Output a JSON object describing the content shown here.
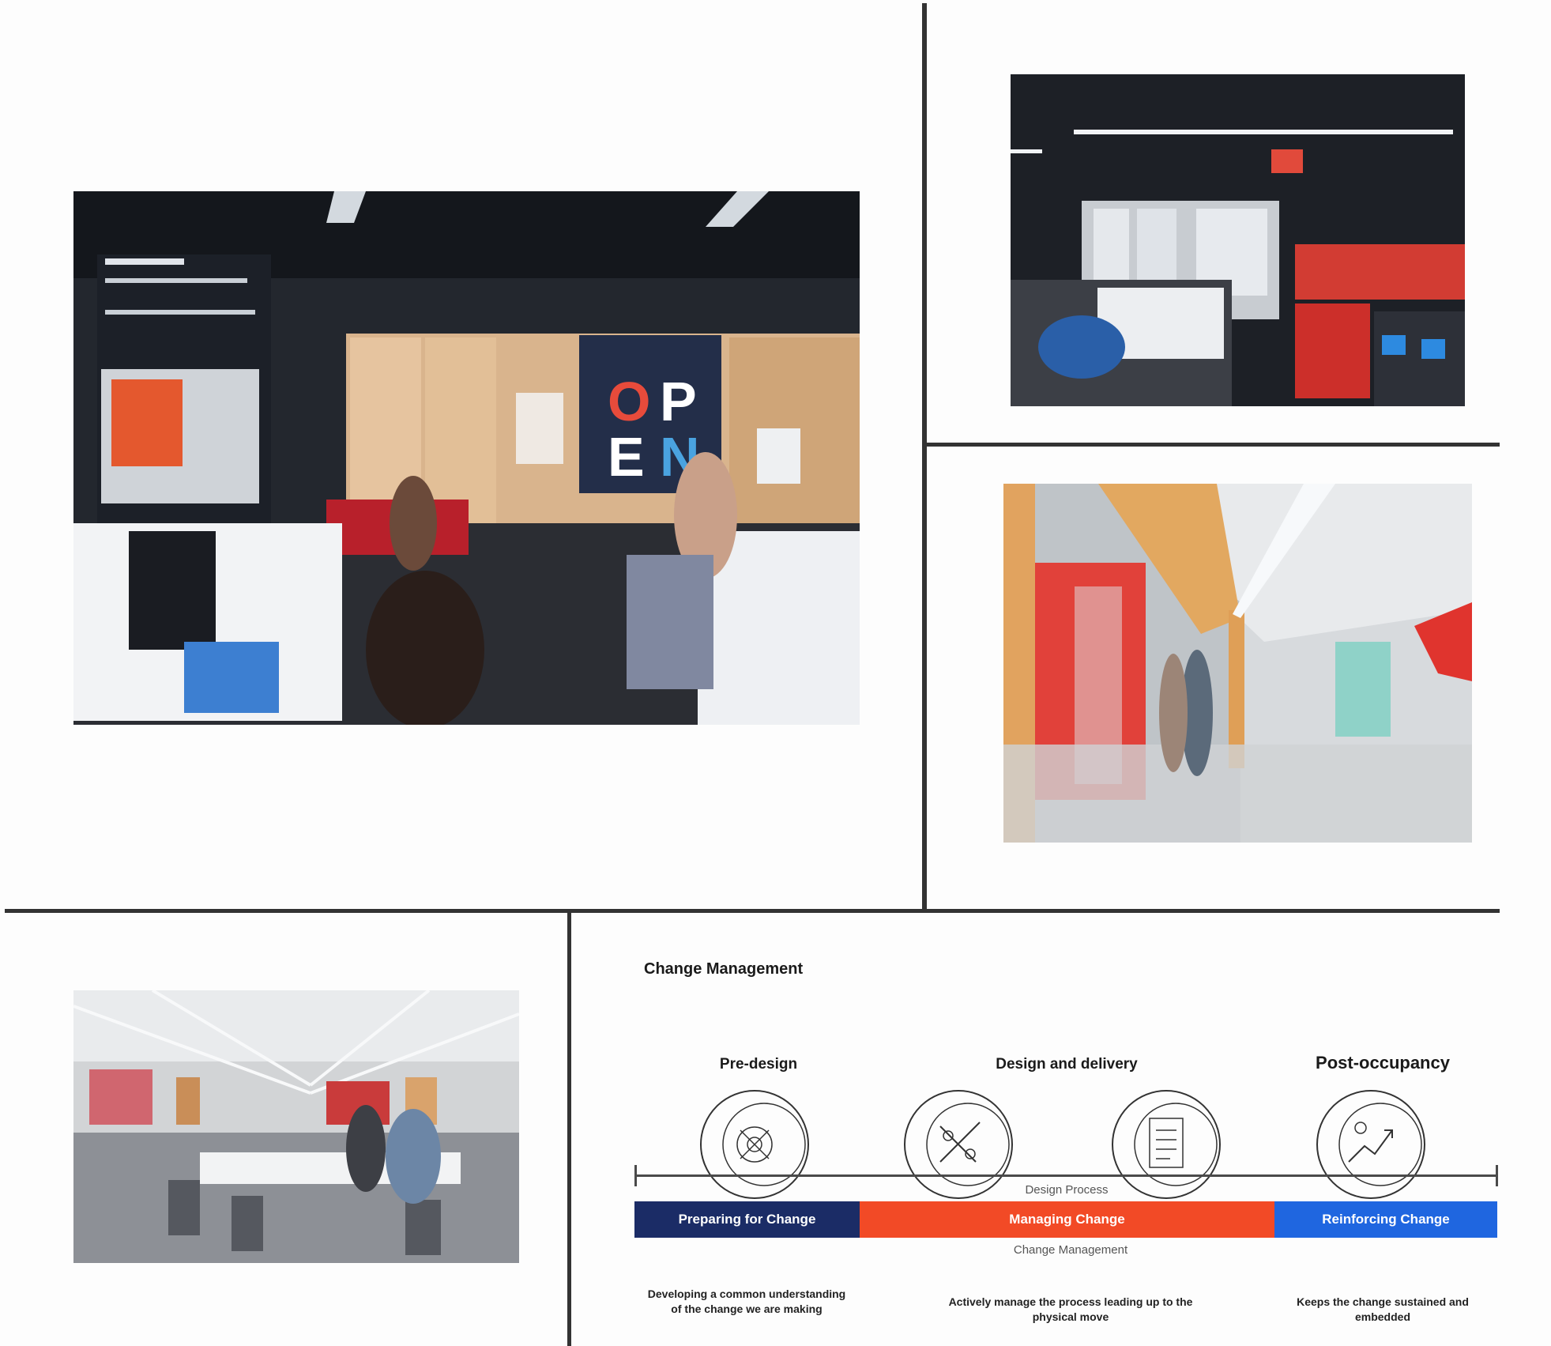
{
  "photos": {
    "main_office": {
      "sign_text": "OPEN",
      "sign_letters": [
        "O",
        "P",
        "E",
        "N"
      ]
    },
    "open_workspace": {},
    "corridor": {},
    "cafe_area": {}
  },
  "change_management": {
    "title": "Change Management",
    "phases": [
      {
        "label": "Pre-design",
        "icon": "strategy-target-icon"
      },
      {
        "label": "Design and delivery",
        "icon": "design-tools-icon"
      },
      {
        "label": "Design and delivery",
        "icon": "checklist-plan-icon"
      },
      {
        "label": "Post-occupancy",
        "icon": "growth-people-icon"
      }
    ],
    "timeline_label_top": "Design Process",
    "timeline_label_bottom": "Change Management",
    "stages": [
      {
        "label": "Preparing for Change",
        "color": "#1b2c66"
      },
      {
        "label": "Managing Change",
        "color": "#f24a26"
      },
      {
        "label": "Reinforcing Change",
        "color": "#1f66e0"
      }
    ],
    "descriptions": [
      "Developing a common understanding of the change we are making",
      "Actively manage the process leading up to the physical move",
      "Keeps the change sustained and embedded"
    ]
  }
}
